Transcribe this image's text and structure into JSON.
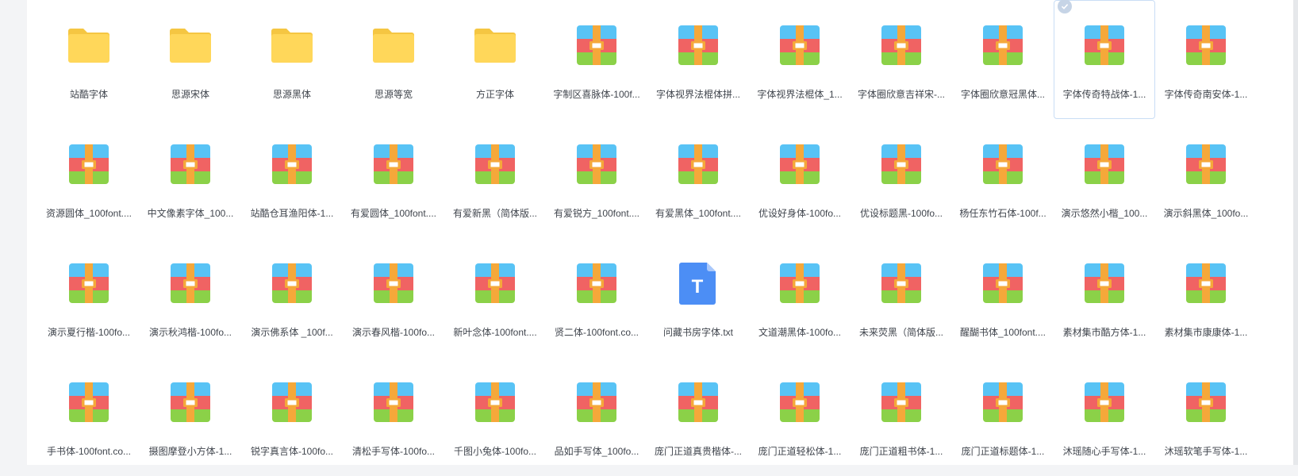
{
  "colors": {
    "folder_back": "#f5c642",
    "folder_front": "#ffd75a",
    "archive_top": "#58c3f5",
    "archive_mid": "#f06363",
    "archive_bottom": "#8bd148",
    "archive_band": "#f5a83a",
    "txt_blue": "#4c8ef5",
    "selection_border": "#c9ddf5"
  },
  "files": [
    {
      "name": "站酷字体",
      "icon": "folder-icon"
    },
    {
      "name": "思源宋体",
      "icon": "folder-icon"
    },
    {
      "name": "思源黑体",
      "icon": "folder-icon"
    },
    {
      "name": "思源等宽",
      "icon": "folder-icon"
    },
    {
      "name": "方正字体",
      "icon": "folder-icon"
    },
    {
      "name": "字制区喜脉体-100f...",
      "icon": "archive-icon"
    },
    {
      "name": "字体视界法棍体拼...",
      "icon": "archive-icon"
    },
    {
      "name": "字体视界法棍体_1...",
      "icon": "archive-icon"
    },
    {
      "name": "字体圈欣意吉祥宋-...",
      "icon": "archive-icon"
    },
    {
      "name": "字体圈欣意冠黑体...",
      "icon": "archive-icon"
    },
    {
      "name": "字体传奇特战体-1...",
      "icon": "archive-icon",
      "selected": true
    },
    {
      "name": "字体传奇南安体-1...",
      "icon": "archive-icon"
    },
    {
      "name": "资源圆体_100font....",
      "icon": "archive-icon"
    },
    {
      "name": "中文像素字体_100...",
      "icon": "archive-icon"
    },
    {
      "name": "站酷仓耳渔阳体-1...",
      "icon": "archive-icon"
    },
    {
      "name": "有爱圆体_100font....",
      "icon": "archive-icon"
    },
    {
      "name": "有爱新黑（简体版...",
      "icon": "archive-icon"
    },
    {
      "name": "有爱锐方_100font....",
      "icon": "archive-icon"
    },
    {
      "name": "有爱黑体_100font....",
      "icon": "archive-icon"
    },
    {
      "name": "优设好身体-100fo...",
      "icon": "archive-icon"
    },
    {
      "name": "优设标题黑-100fo...",
      "icon": "archive-icon"
    },
    {
      "name": "杨任东竹石体-100f...",
      "icon": "archive-icon"
    },
    {
      "name": "演示悠然小楷_100...",
      "icon": "archive-icon"
    },
    {
      "name": "演示斜黑体_100fo...",
      "icon": "archive-icon"
    },
    {
      "name": "演示夏行楷-100fo...",
      "icon": "archive-icon"
    },
    {
      "name": "演示秋鸿楷-100fo...",
      "icon": "archive-icon"
    },
    {
      "name": "演示佛系体 _100f...",
      "icon": "archive-icon"
    },
    {
      "name": "演示春风楷-100fo...",
      "icon": "archive-icon"
    },
    {
      "name": "新叶念体-100font....",
      "icon": "archive-icon"
    },
    {
      "name": "贤二体-100font.co...",
      "icon": "archive-icon"
    },
    {
      "name": "问藏书房字体.txt",
      "icon": "txt-icon"
    },
    {
      "name": "文道潮黑体-100fo...",
      "icon": "archive-icon"
    },
    {
      "name": "未来荧黑（简体版...",
      "icon": "archive-icon"
    },
    {
      "name": "醒醐书体_100font....",
      "icon": "archive-icon"
    },
    {
      "name": "素材集市酷方体-1...",
      "icon": "archive-icon"
    },
    {
      "name": "素材集市康康体-1...",
      "icon": "archive-icon"
    },
    {
      "name": "手书体-100font.co...",
      "icon": "archive-icon"
    },
    {
      "name": "摄图摩登小方体-1...",
      "icon": "archive-icon"
    },
    {
      "name": "锐字真言体-100fo...",
      "icon": "archive-icon"
    },
    {
      "name": "清松手写体-100fo...",
      "icon": "archive-icon"
    },
    {
      "name": "千图小兔体-100fo...",
      "icon": "archive-icon"
    },
    {
      "name": "品如手写体_100fo...",
      "icon": "archive-icon"
    },
    {
      "name": "庞门正道真贵楷体-...",
      "icon": "archive-icon"
    },
    {
      "name": "庞门正道轻松体-1...",
      "icon": "archive-icon"
    },
    {
      "name": "庞门正道粗书体-1...",
      "icon": "archive-icon"
    },
    {
      "name": "庞门正道标题体-1...",
      "icon": "archive-icon"
    },
    {
      "name": "沐瑶随心手写体-1...",
      "icon": "archive-icon"
    },
    {
      "name": "沐瑶软笔手写体-1...",
      "icon": "archive-icon"
    }
  ]
}
